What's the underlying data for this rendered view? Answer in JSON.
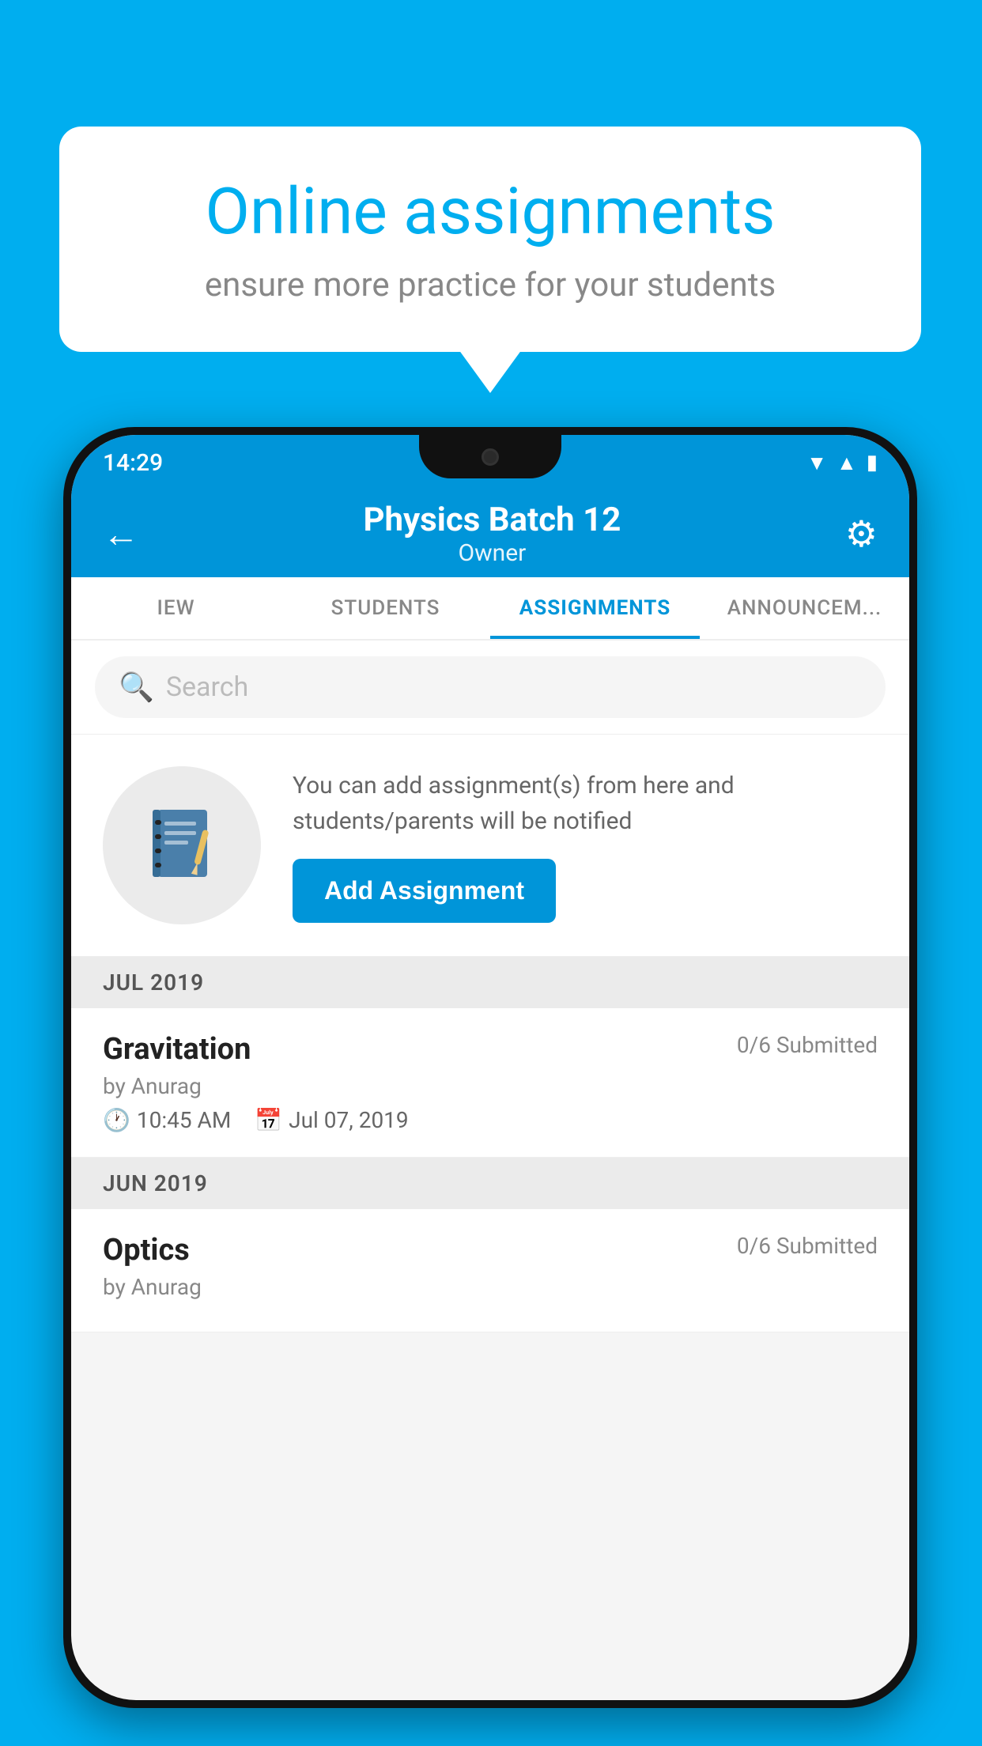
{
  "background_color": "#00AEEF",
  "speech_bubble": {
    "title": "Online assignments",
    "subtitle": "ensure more practice for your students"
  },
  "phone": {
    "status_bar": {
      "time": "14:29",
      "icons": [
        "wifi",
        "signal",
        "battery"
      ]
    },
    "header": {
      "title": "Physics Batch 12",
      "subtitle": "Owner",
      "back_label": "←",
      "gear_label": "⚙"
    },
    "tabs": [
      {
        "label": "IEW",
        "active": false
      },
      {
        "label": "STUDENTS",
        "active": false
      },
      {
        "label": "ASSIGNMENTS",
        "active": true
      },
      {
        "label": "ANNOUNCEM...",
        "active": false
      }
    ],
    "search": {
      "placeholder": "Search"
    },
    "promo": {
      "description": "You can add assignment(s) from here and students/parents will be notified",
      "button_label": "Add Assignment"
    },
    "sections": [
      {
        "month": "JUL 2019",
        "assignments": [
          {
            "name": "Gravitation",
            "submitted": "0/6 Submitted",
            "by": "by Anurag",
            "time": "10:45 AM",
            "date": "Jul 07, 2019"
          }
        ]
      },
      {
        "month": "JUN 2019",
        "assignments": [
          {
            "name": "Optics",
            "submitted": "0/6 Submitted",
            "by": "by Anurag",
            "time": "",
            "date": ""
          }
        ]
      }
    ]
  }
}
